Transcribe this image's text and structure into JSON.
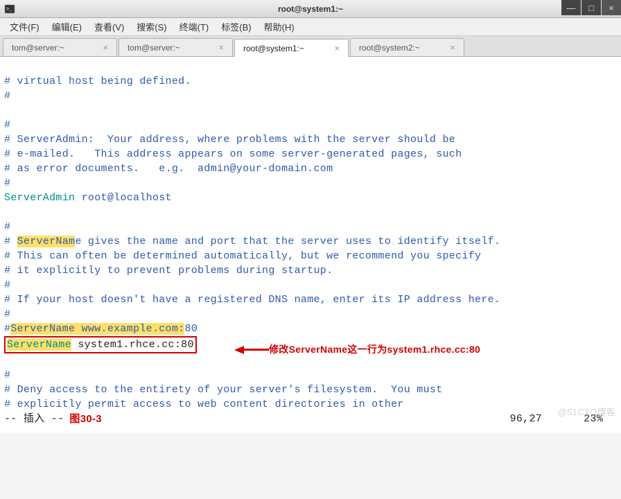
{
  "titlebar": {
    "title": "root@system1:~"
  },
  "window_controls": {
    "minimize": "—",
    "maximize": "□",
    "close": "×"
  },
  "menubar": {
    "items": [
      "文件(F)",
      "编辑(E)",
      "查看(V)",
      "搜索(S)",
      "终端(T)",
      "标签(B)",
      "帮助(H)"
    ]
  },
  "tabs": [
    {
      "label": "tom@server:~",
      "active": false
    },
    {
      "label": "tom@server:~",
      "active": false
    },
    {
      "label": "root@system1:~",
      "active": true
    },
    {
      "label": "root@system2:~",
      "active": false
    }
  ],
  "terminal": {
    "lines": {
      "l0": "# virtual host being defined.",
      "l1": "#",
      "l2": "",
      "l3": "#",
      "l4": "# ServerAdmin:  Your address, where problems with the server should be",
      "l5": "# e-mailed.   This address appears on some server-generated pages, such",
      "l6": "# as error documents.   e.g.  admin@your-domain.com",
      "l7": "#",
      "l8_dir": "ServerAdmin",
      "l8_val": " root@localhost",
      "l9": "",
      "l10": "#",
      "l11_a": "# ",
      "l11_hi": "ServerNam",
      "l11_b": "e gives the name and port that the server uses to identify itself.",
      "l12": "# This can often be determined automatically, but we recommend you specify",
      "l13": "# it explicitly to prevent problems during startup.",
      "l14": "#",
      "l15": "# If your host doesn't have a registered DNS name, enter its IP address here.",
      "l16": "#",
      "l17_a": "#",
      "l17_hi": "ServerName www.example.com:",
      "l17_b": "80",
      "l18_dir": "ServerName",
      "l18_val": " system1.rhce.cc:80",
      "l19": "",
      "l20": "#",
      "l21": "# Deny access to the entirety of your server's filesystem.  You must",
      "l22": "# explicitly permit access to web content directories in other"
    },
    "status": {
      "mode": "-- 插入 --",
      "figure": "图30-3",
      "position": "96,27",
      "percent": "23%"
    }
  },
  "annotation": {
    "text": "修改ServerName这一行为system1.rhce.cc:80"
  },
  "watermark": "@51CTO博客"
}
